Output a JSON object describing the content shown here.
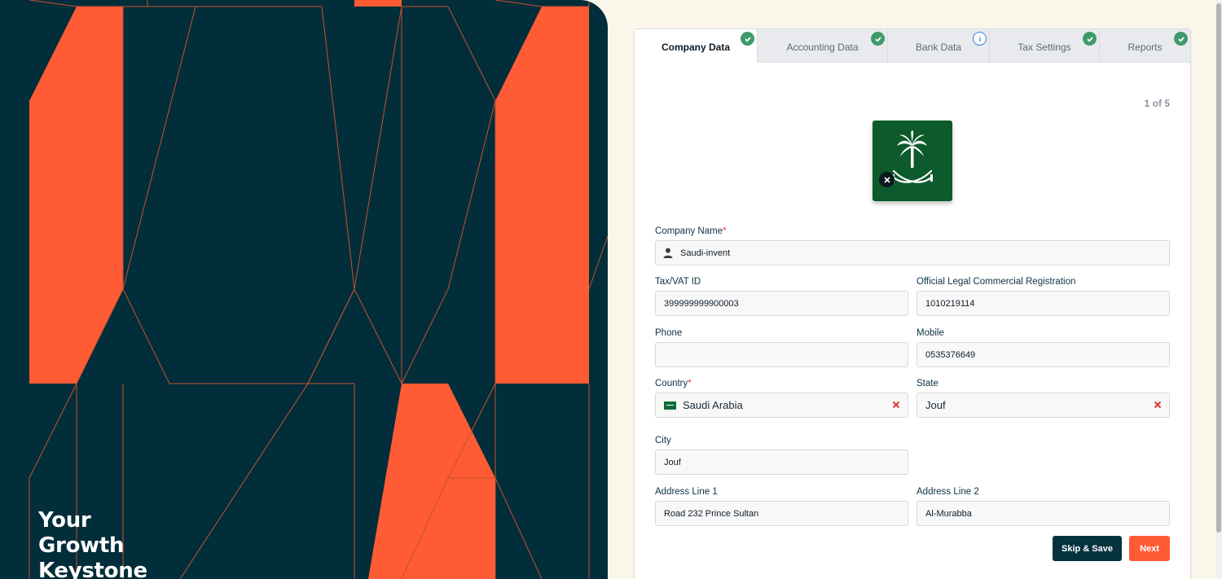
{
  "hero": {
    "line1": "Your",
    "line2": "Growth",
    "line3": "Keystone"
  },
  "tabs": [
    {
      "label": "Company Data",
      "status": "complete",
      "active": true
    },
    {
      "label": "Accounting Data",
      "status": "complete",
      "active": false
    },
    {
      "label": "Bank Data",
      "status": "info",
      "active": false
    },
    {
      "label": "Tax Settings",
      "status": "complete",
      "active": false
    },
    {
      "label": "Reports",
      "status": "complete",
      "active": false
    }
  ],
  "step": "1 of 5",
  "form": {
    "company_name": {
      "label": "Company Name",
      "value": "Saudi-invent",
      "required": "*"
    },
    "tax_vat": {
      "label": "Tax/VAT ID",
      "value": "399999999900003"
    },
    "commercial_reg": {
      "label": "Official Legal Commercial Registration",
      "value": "1010219114"
    },
    "phone": {
      "label": "Phone",
      "value": ""
    },
    "mobile": {
      "label": "Mobile",
      "value": "0535376649"
    },
    "country": {
      "label": "Country",
      "value": "Saudi Arabia",
      "required": "*"
    },
    "state": {
      "label": "State",
      "value": "Jouf"
    },
    "city": {
      "label": "City",
      "value": "Jouf"
    },
    "address1": {
      "label": "Address Line 1",
      "value": "Road 232 Prince Sultan"
    },
    "address2": {
      "label": "Address Line 2",
      "value": "Al-Murabba"
    }
  },
  "buttons": {
    "skip_save": "Skip & Save",
    "next": "Next"
  },
  "colors": {
    "hero_bg": "#022d3a",
    "accent": "#ff5c35",
    "primary_dark": "#063240",
    "check_green": "#3f9a6a",
    "logo_green": "#0d5a2c"
  },
  "icons": {
    "tab_complete": "check-circle-icon",
    "tab_info": "info-circle-icon",
    "company_field": "user-icon",
    "clear": "close-icon"
  }
}
